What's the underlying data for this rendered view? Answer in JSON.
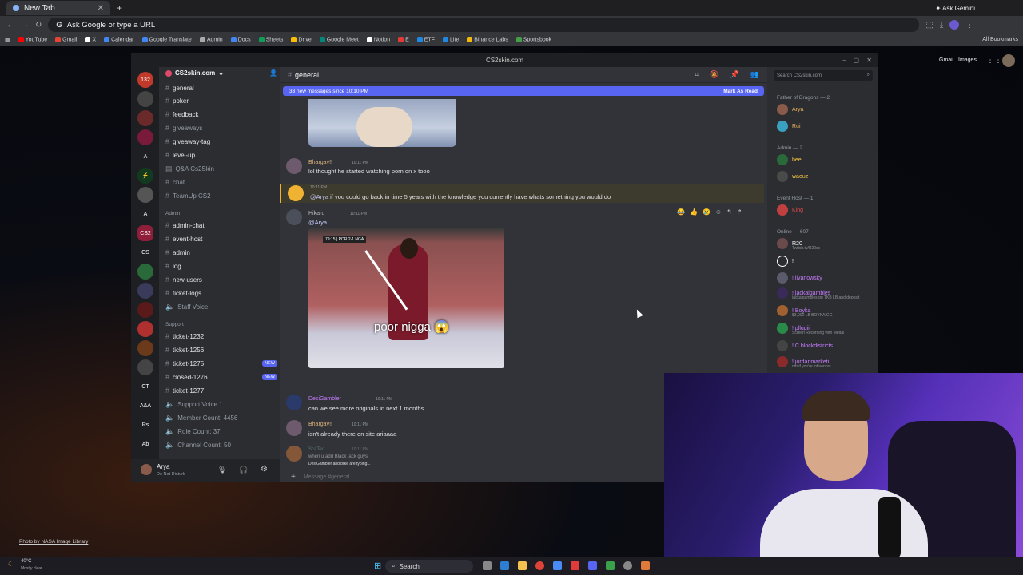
{
  "browser": {
    "tab_title": "New Tab",
    "omnibox_placeholder": "Ask Google or type a URL",
    "gemini_label": "Ask Gemini",
    "bookmarks": [
      "YouTube",
      "Gmail",
      "X",
      "Calendar",
      "Google Translate",
      "Admin",
      "Docs",
      "Sheets",
      "Drive",
      "Google Meet",
      "Notion",
      "E",
      "ETF",
      "Lite",
      "Binance Labs",
      "Sportsbook"
    ],
    "all_bookmarks": "All Bookmarks",
    "gmail": "Gmail",
    "images": "Images"
  },
  "window": {
    "title": "CS2skin.com"
  },
  "server": {
    "name": "CS2skin.com"
  },
  "servers": [
    "132",
    "A",
    "A",
    "CS2",
    "CS",
    "CT",
    "A&A",
    "Rs",
    "Ab"
  ],
  "channels": {
    "items": [
      {
        "name": "general",
        "dim": false
      },
      {
        "name": "poker",
        "dim": false
      },
      {
        "name": "feedback",
        "dim": false
      },
      {
        "name": "giveaways",
        "dim": true
      },
      {
        "name": "giveaway-tag",
        "dim": false
      },
      {
        "name": "level-up",
        "dim": false
      },
      {
        "name": "Q&A Cs2Skin",
        "dim": true
      },
      {
        "name": "chat",
        "dim": true
      },
      {
        "name": "TeamUp CS2",
        "dim": true
      }
    ],
    "admin_category": "Admin",
    "admin_items": [
      "admin-chat",
      "event-host",
      "admin",
      "log",
      "new-users",
      "ticket-logs",
      "Staff Voice"
    ],
    "support_category": "Support",
    "support_items": [
      {
        "name": "ticket-1232",
        "badge": ""
      },
      {
        "name": "ticket-1256",
        "badge": ""
      },
      {
        "name": "ticket-1275",
        "badge": "NEW"
      },
      {
        "name": "closed-1276",
        "badge": "NEW"
      },
      {
        "name": "ticket-1277",
        "badge": ""
      }
    ],
    "voice": [
      "Support Voice 1",
      "Member Count: 4456",
      "Role Count: 37",
      "Channel Count: 50"
    ]
  },
  "user": {
    "name": "Arya",
    "status": "Do Not Disturb"
  },
  "chat": {
    "channel": "general",
    "new_messages": "33 new messages since 10:10 PM",
    "mark_read": "Mark As Read",
    "messages": [
      {
        "author": "Bhargav!!",
        "time": "10:11 PM",
        "text": "lol thought he started watching porn on x tooo"
      },
      {
        "author": "",
        "time": "10:11 PM",
        "mention": "@Arya",
        "text": " if you could go back in time 5 years with the knowledge you currently have whats something you would do"
      },
      {
        "author": "Hikaru",
        "time": "10:11 PM",
        "mention": "@Arya",
        "text": ""
      },
      {
        "author": "DesiGambler",
        "time": "10:11 PM",
        "text": "can we see more originals in next 1 months"
      },
      {
        "author": "Bhargav!!",
        "time": "10:11 PM",
        "text": "isn't already there on site ariaaaa"
      },
      {
        "author": "ScaTeo",
        "time": "10:11 PM",
        "text": "when u add Black jack guys"
      }
    ],
    "gif_caption": "poor nigga 😱",
    "scoreboard": "79:15 | POR 2-1 NGA",
    "typing": "DesiGambler and brke are typing...",
    "input_placeholder": "Message #general"
  },
  "members": {
    "search_placeholder": "Search CS2skin.com",
    "groups": [
      {
        "label": "Father of Dragons — 2",
        "items": [
          {
            "name": "Arya",
            "color": "#e8b35a"
          },
          {
            "name": "Rui",
            "color": "#e8b35a"
          }
        ]
      },
      {
        "label": "Admin — 2",
        "items": [
          {
            "name": "bee",
            "color": "#f5c542"
          },
          {
            "name": "waouz",
            "color": "#f5c542"
          }
        ]
      },
      {
        "label": "Event Host — 1",
        "items": [
          {
            "name": "King",
            "color": "#e04a4a"
          }
        ]
      },
      {
        "label": "Online — 607",
        "items": [
          {
            "name": "R20",
            "color": "#ffffff",
            "sub": "Twitch.tv/R20cs"
          },
          {
            "name": "!",
            "color": "#ffffff",
            "sub": ""
          },
          {
            "name": "! livanowsky",
            "color": "#c77dff",
            "sub": ""
          },
          {
            "name": "! jackalgambles",
            "color": "#c77dff",
            "sub": "jackalgambles.gg TKB LB and deposit"
          },
          {
            "name": "! Boyka",
            "color": "#c77dff",
            "sub": "$3,000 LB BOYKA.GG"
          },
          {
            "name": "! pllugii",
            "color": "#c77dff",
            "sub": "Screen Recording with Medal"
          },
          {
            "name": "! C blockdistricts",
            "color": "#c77dff",
            "sub": ""
          },
          {
            "name": "! jordanmarketi...",
            "color": "#c77dff",
            "sub": "dm if you're influencer"
          }
        ]
      }
    ]
  },
  "desktop": {
    "photo_credit": "Photo by NASA Image Library"
  },
  "taskbar": {
    "temp": "40°C",
    "weather": "Mostly clear",
    "search": "Search"
  }
}
